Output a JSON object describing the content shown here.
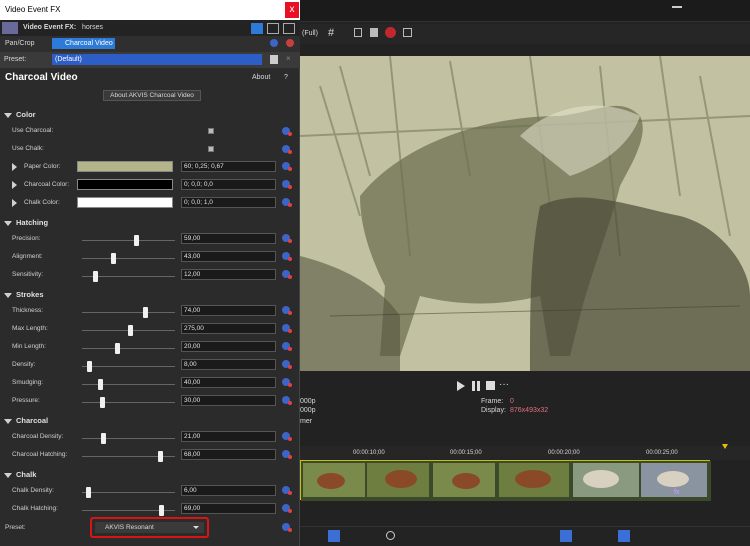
{
  "dialog": {
    "title": "Video Event FX",
    "close_label": "x",
    "fx_label": "Video Event FX:",
    "fx_name": "horses",
    "chain": [
      "Pan/Crop",
      "Charcoal Video"
    ],
    "preset_label": "Preset:",
    "preset_value": "(Default)",
    "plugin_title": "Charcoal Video",
    "about_link": "About",
    "help_label": "?",
    "about_button": "About AKVIS Charcoal Video"
  },
  "sections": {
    "color": "Color",
    "hatching": "Hatching",
    "strokes": "Strokes",
    "charcoal": "Charcoal",
    "chalk": "Chalk"
  },
  "params": {
    "use_charcoal": "Use Charcoal:",
    "use_chalk": "Use Chalk:",
    "paper_color": {
      "label": "Paper Color:",
      "value": "60; 0,25; 0,67",
      "hex": "#b4b48a"
    },
    "charcoal_color": {
      "label": "Charcoal Color:",
      "value": "0; 0,0; 0,0",
      "hex": "#000000"
    },
    "chalk_color": {
      "label": "Chalk Color:",
      "value": "0; 0,0; 1,0",
      "hex": "#ffffff"
    },
    "precision": {
      "label": "Precision:",
      "value": "59,00",
      "level": 0.59
    },
    "alignment": {
      "label": "Alignment:",
      "value": "43,00",
      "level": 0.33
    },
    "sensitivity": {
      "label": "Sensitivity:",
      "value": "12,00",
      "level": 0.12
    },
    "thickness": {
      "label": "Thickness:",
      "value": "74,00",
      "level": 0.69
    },
    "max_length": {
      "label": "Max Length:",
      "value": "275,00",
      "level": 0.52
    },
    "min_length": {
      "label": "Min Length:",
      "value": "20,00",
      "level": 0.38
    },
    "density": {
      "label": "Density:",
      "value": "8,00",
      "level": 0.06
    },
    "smudging": {
      "label": "Smudging:",
      "value": "40,00",
      "level": 0.18
    },
    "pressure": {
      "label": "Pressure:",
      "value": "30,00",
      "level": 0.2
    },
    "charcoal_density": {
      "label": "Charcoal Density:",
      "value": "21,00",
      "level": 0.22
    },
    "charcoal_hatching": {
      "label": "Charcoal Hatching:",
      "value": "68,00",
      "level": 0.86
    },
    "chalk_density": {
      "label": "Chalk Density:",
      "value": "6,00",
      "level": 0.04
    },
    "chalk_hatching": {
      "label": "Chalk Hatching:",
      "value": "69,00",
      "level": 0.87
    },
    "preset_label": "Preset:",
    "preset_value": "AKVIS Resonant"
  },
  "host": {
    "zoom": "(Full)",
    "frame_label": "Frame:",
    "frame_value": "0",
    "display_label": "Display:",
    "display_value": "876x493x32",
    "res_1": "000p",
    "res_2": "000p",
    "mixer_fragment": "mer",
    "times": [
      "00:00:10;00",
      "00:00:15;00",
      "00:00:20;00",
      "00:00:25;00"
    ]
  }
}
